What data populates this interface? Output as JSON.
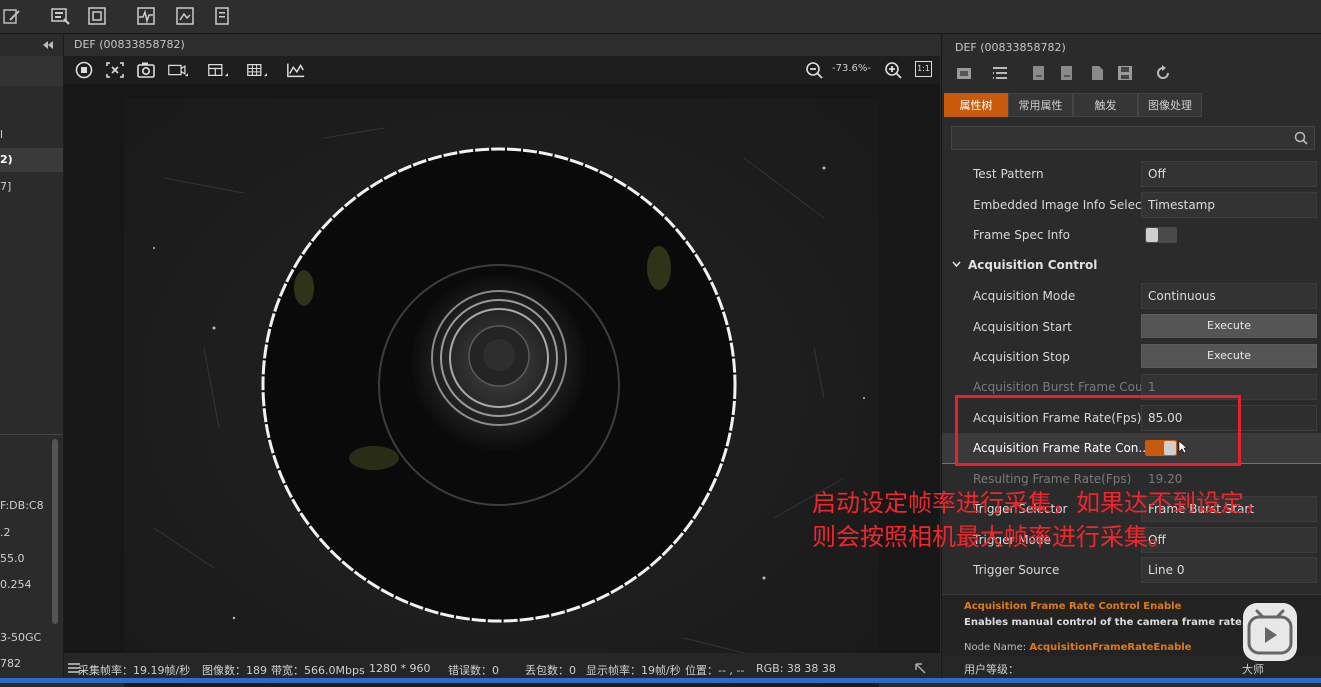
{
  "window": {
    "center_title": "DEF (00833858782)",
    "right_title": "DEF (00833858782)"
  },
  "sidebar": {
    "fragments": [
      "l",
      "2)",
      "7]",
      "F:DB:C8",
      ".2",
      "55.0",
      "0.254",
      "3-50GC",
      "782"
    ]
  },
  "view_toolbar": {
    "zoom": "-73.6%-",
    "ratio": "1:1"
  },
  "status_bar": {
    "frame_rate": "采集帧率：19.19帧/秒",
    "image_count": "图像数：189",
    "bandwidth": "带宽：566.0Mbps",
    "resolution": "1280 * 960",
    "errors": "错误数：0",
    "lost": "丢包数：0",
    "display_rate": "显示帧率：19帧/秒",
    "position": "位置：-- , --",
    "rgb": "RGB: 38 38 38"
  },
  "right_panel": {
    "tabs": [
      "属性树",
      "常用属性",
      "触发",
      "图像处理"
    ],
    "active_tab": 0,
    "properties": [
      {
        "label": "Test Pattern",
        "value": "Off"
      },
      {
        "label": "Embedded Image Info Selec...",
        "value": "Timestamp"
      },
      {
        "label": "Frame Spec Info",
        "value": ""
      }
    ],
    "section": "Acquisition Control",
    "acq_properties": [
      {
        "label": "Acquisition Mode",
        "value": "Continuous"
      },
      {
        "label": "Acquisition Start",
        "button": "Execute"
      },
      {
        "label": "Acquisition Stop",
        "button": "Execute"
      },
      {
        "label": "Acquisition Burst Frame Cou...",
        "value": "1"
      },
      {
        "label": "Acquisition Frame Rate(Fps)",
        "value": "85.00"
      },
      {
        "label": "Acquisition Frame Rate Con...",
        "value": ""
      },
      {
        "label": "Resulting Frame Rate(Fps)",
        "value": "19.20"
      },
      {
        "label": "Trigger Selector",
        "value": "Frame Burst Start"
      },
      {
        "label": "Trigger Mode",
        "value": "Off"
      },
      {
        "label": "Trigger Source",
        "value": "Line 0"
      }
    ],
    "description_title": "Acquisition Frame Rate Control Enable",
    "description_text": "Enables manual control of the camera frame rate.",
    "node_name_label": "Node Name:",
    "node_name_value": "AcquisitionFrameRateEnable",
    "user_level_label": "用户等级：",
    "user_level_value": "大师"
  },
  "annotation": {
    "text": "启动设定帧率进行采集，如果达不到设定，则会按照相机最大帧率进行采集。"
  },
  "colors": {
    "accent": "#c85a0b",
    "highlight": "#e8212b",
    "annotation": "#f0262d"
  }
}
